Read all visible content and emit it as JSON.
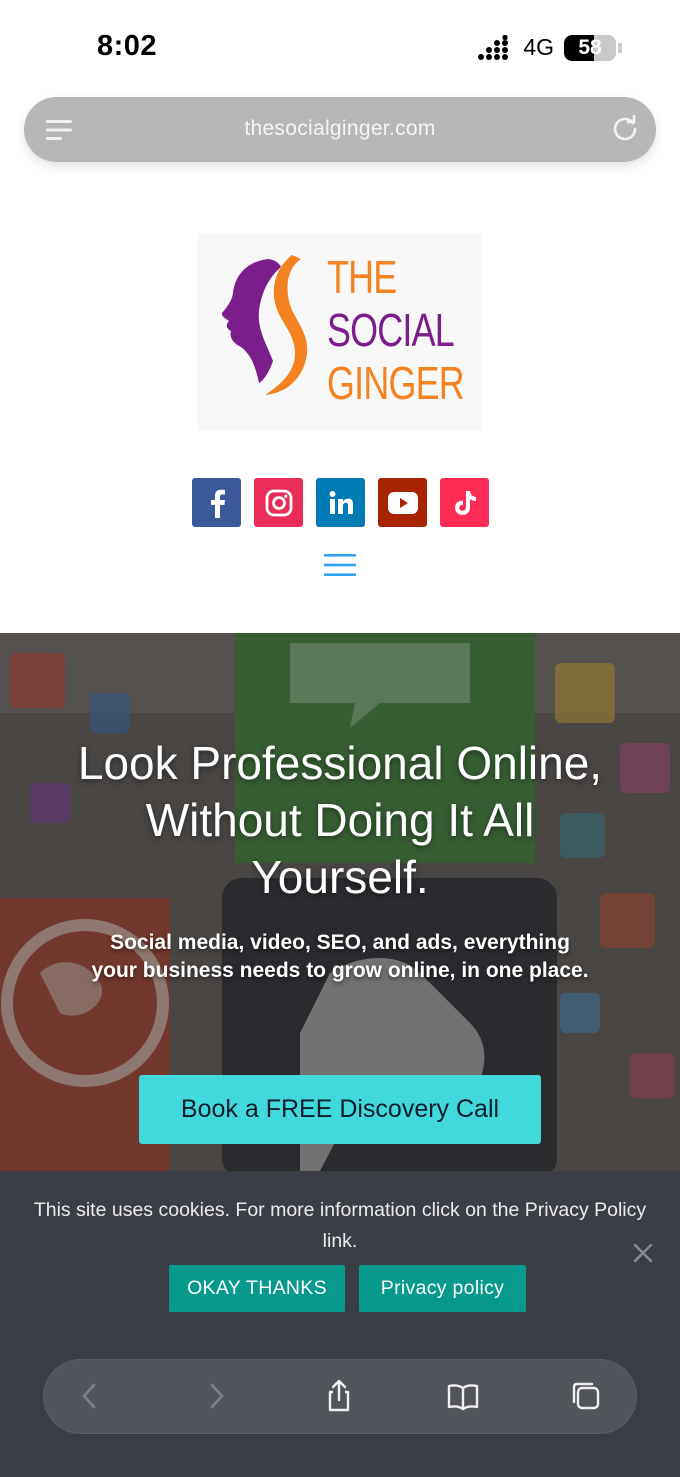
{
  "status_bar": {
    "time": "8:02",
    "network": "4G",
    "battery": "58",
    "battery_level": 0.58
  },
  "browser": {
    "url": "thesocialginger.com"
  },
  "logo": {
    "line1": "THE",
    "line2": "SOCIAL",
    "line3": "GINGER"
  },
  "social_links": [
    {
      "name": "facebook",
      "color": "#3b5998",
      "icon": "facebook-icon"
    },
    {
      "name": "instagram",
      "color": "#ea2c59",
      "icon": "instagram-icon"
    },
    {
      "name": "linkedin",
      "color": "#007bb6",
      "icon": "linkedin-icon"
    },
    {
      "name": "youtube",
      "color": "#a82400",
      "icon": "youtube-icon"
    },
    {
      "name": "tiktok",
      "color": "#fe2c55",
      "icon": "tiktok-icon"
    }
  ],
  "hero": {
    "title": "Look Professional Online, Without Doing It All Yourself.",
    "subtitle": "Social media, video, SEO, and ads, everything your business needs to grow online, in one place.",
    "cta_label": "Book a FREE Discovery Call",
    "cta_color": "#42d9dc"
  },
  "cookie_banner": {
    "text": "This site uses cookies. For more information click on the Privacy Policy link.",
    "okay_label": "OKAY THANKS",
    "privacy_label": "Privacy policy",
    "button_color": "#079a8c"
  },
  "colors": {
    "accent_blue": "#2ea3f2",
    "logo_orange": "#f58220",
    "logo_purple": "#7b1e8c"
  }
}
